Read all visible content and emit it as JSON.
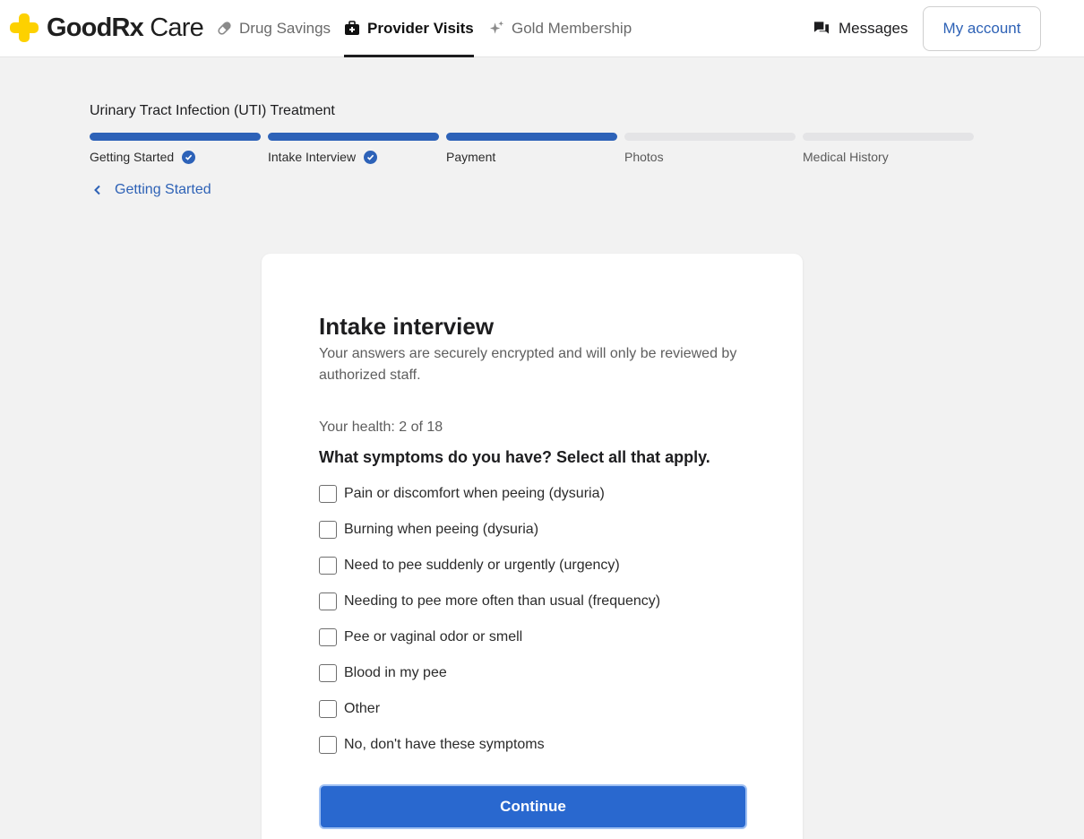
{
  "brand": {
    "name_bold": "GoodRx",
    "name_regular": " Care",
    "logo_color": "#fdd100"
  },
  "nav": {
    "drug_savings": "Drug Savings",
    "provider_visits": "Provider Visits",
    "gold_membership": "Gold Membership",
    "messages": "Messages",
    "my_account": "My account"
  },
  "flow": {
    "title": "Urinary Tract Infection (UTI) Treatment",
    "steps": [
      {
        "label": "Getting Started",
        "status": "complete"
      },
      {
        "label": "Intake Interview",
        "status": "complete"
      },
      {
        "label": "Payment",
        "status": "active"
      },
      {
        "label": "Photos",
        "status": "upcoming"
      },
      {
        "label": "Medical History",
        "status": "upcoming"
      }
    ],
    "back_label": "Getting Started"
  },
  "card": {
    "title": "Intake interview",
    "subtitle": "Your answers are securely encrypted and will only be reviewed by authorized staff.",
    "progress": "Your health: 2 of 18",
    "question": "What symptoms do you have? Select all that apply.",
    "options": [
      {
        "label": "Pain or discomfort when peeing (dysuria)",
        "checked": false
      },
      {
        "label": "Burning when peeing (dysuria)",
        "checked": false
      },
      {
        "label": "Need to pee suddenly or urgently (urgency)",
        "checked": false
      },
      {
        "label": "Needing to pee more often than usual (frequency)",
        "checked": false
      },
      {
        "label": "Pee or vaginal odor or smell",
        "checked": false
      },
      {
        "label": "Blood in my pee",
        "checked": false
      },
      {
        "label": "Other",
        "checked": false
      },
      {
        "label": "No, don't have these symptoms",
        "checked": false
      }
    ],
    "continue_label": "Continue"
  },
  "colors": {
    "accent": "#2d62b8",
    "button": "#2968cf",
    "link": "#2e62b6"
  }
}
